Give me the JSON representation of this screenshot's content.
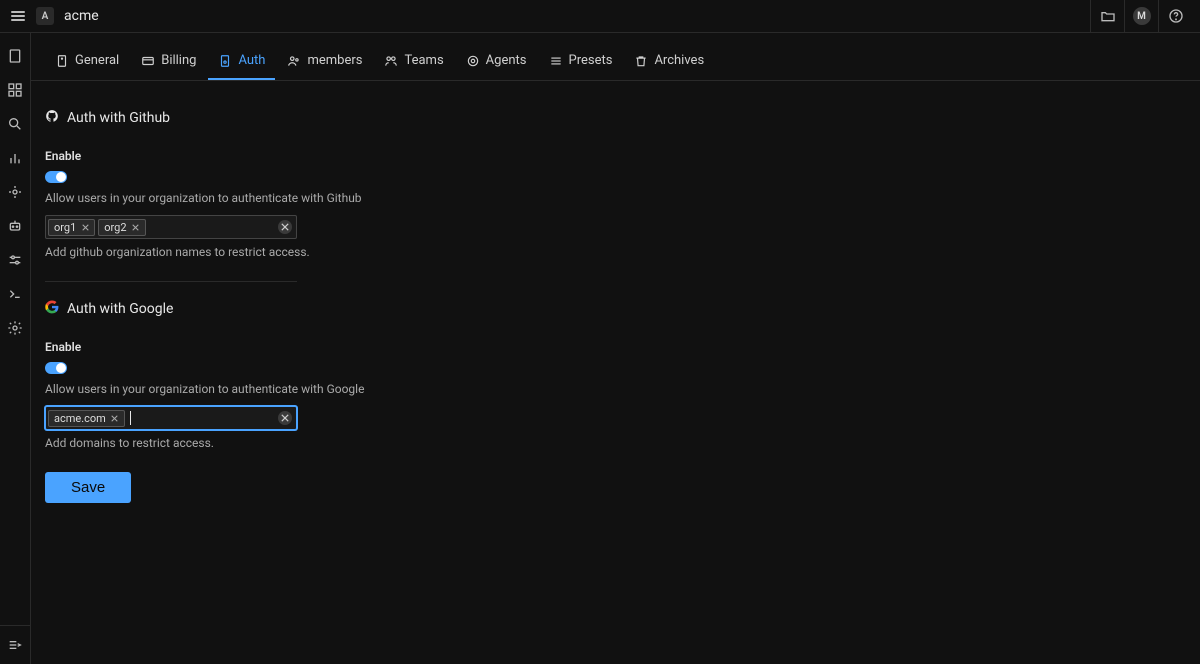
{
  "header": {
    "org_initial": "A",
    "org_name": "acme",
    "user_initial": "M"
  },
  "tabs": [
    {
      "label": "General"
    },
    {
      "label": "Billing"
    },
    {
      "label": "Auth"
    },
    {
      "label": "members"
    },
    {
      "label": "Teams"
    },
    {
      "label": "Agents"
    },
    {
      "label": "Presets"
    },
    {
      "label": "Archives"
    }
  ],
  "auth": {
    "github": {
      "title": "Auth with Github",
      "enable_label": "Enable",
      "enabled": true,
      "help": "Allow users in your organization to authenticate with Github",
      "tags": [
        "org1",
        "org2"
      ],
      "input_help": "Add github organization names to restrict access."
    },
    "google": {
      "title": "Auth with Google",
      "enable_label": "Enable",
      "enabled": true,
      "help": "Allow users in your organization to authenticate with Google",
      "tags": [
        "acme.com"
      ],
      "input_value": "",
      "input_help": "Add domains to restrict access."
    },
    "save_label": "Save"
  }
}
